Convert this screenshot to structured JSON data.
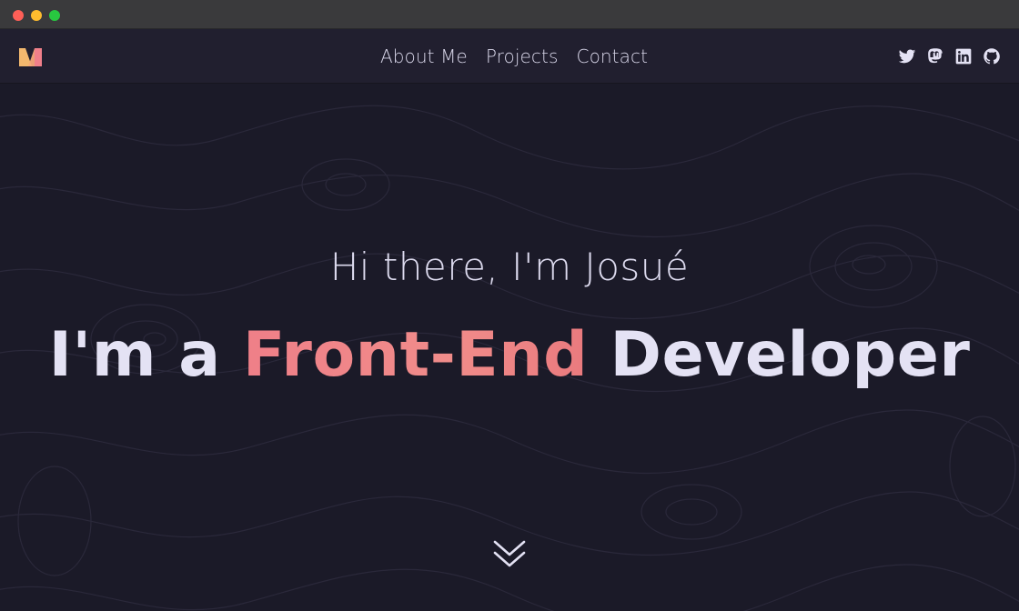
{
  "nav": {
    "links": [
      {
        "label": "About Me"
      },
      {
        "label": "Projects"
      },
      {
        "label": "Contact"
      }
    ],
    "social": [
      "twitter-icon",
      "mastodon-icon",
      "linkedin-icon",
      "github-icon"
    ]
  },
  "hero": {
    "greeting": "Hi there, I'm Josué",
    "headline_prefix": "I'm a ",
    "headline_accent": "Front-End",
    "headline_suffix": " Developer"
  },
  "colors": {
    "background": "#1b1a28",
    "navbar": "#211f2f",
    "accent": "#ef7f88",
    "text": "#e4e2f4",
    "logo_left": "#f3b86e",
    "logo_right": "#f07f8a"
  }
}
